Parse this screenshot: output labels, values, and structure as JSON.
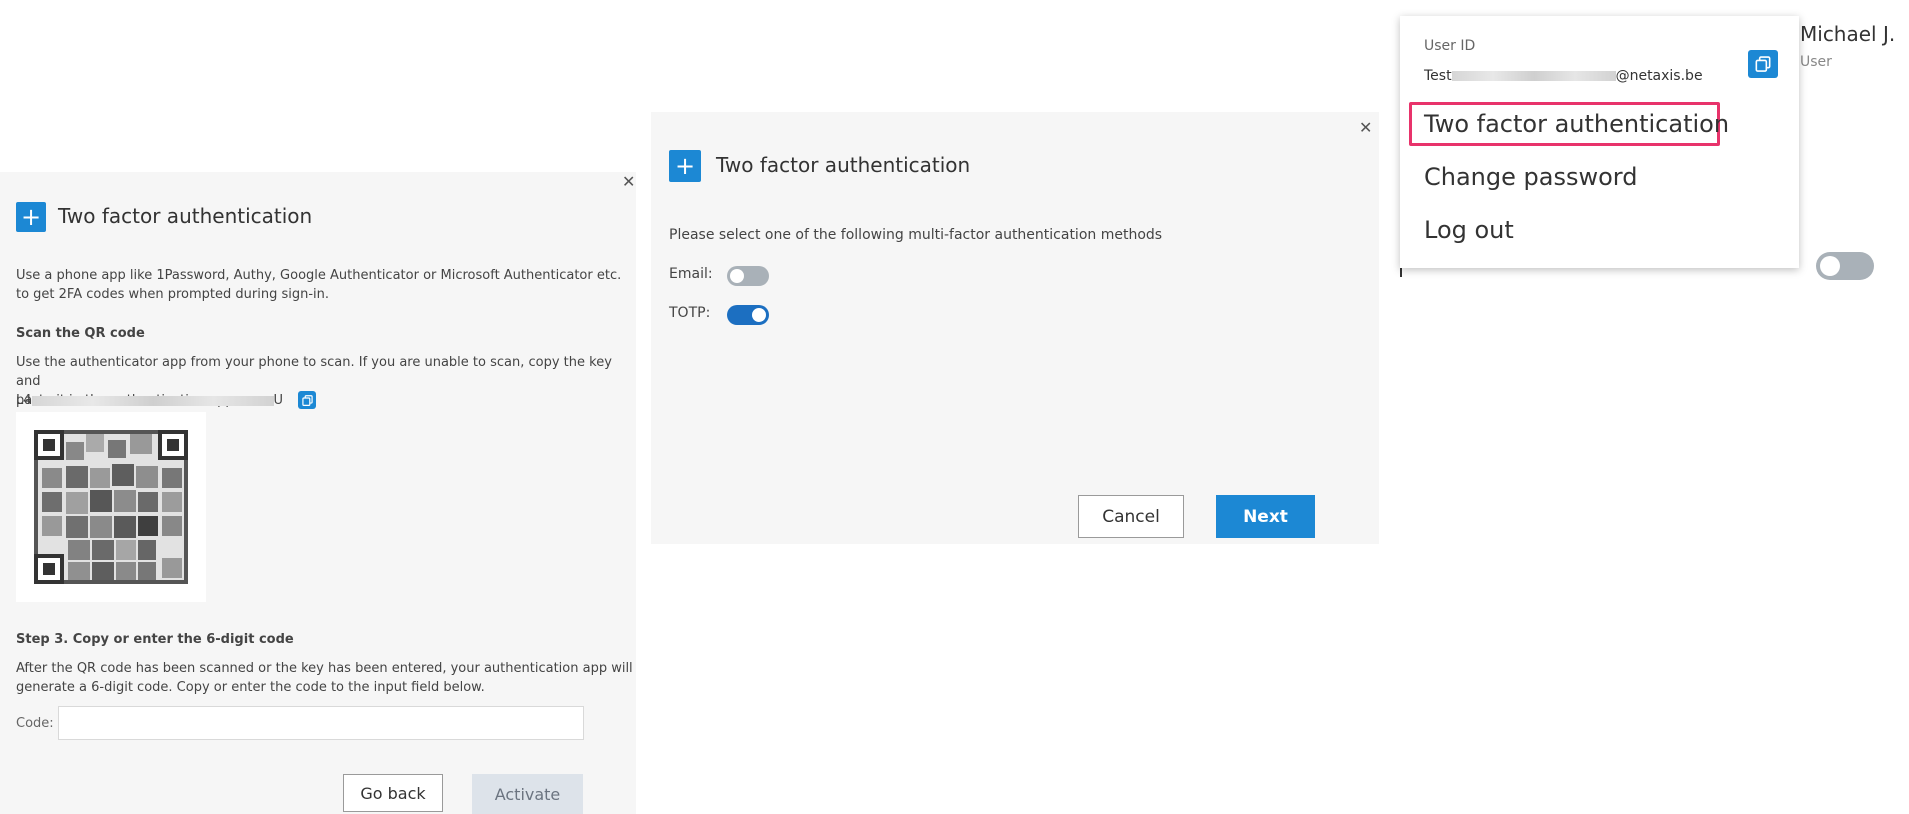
{
  "left_dialog": {
    "title": "Two factor authentication",
    "intro_line1": "Use a phone app like 1Password, Authy, Google Authenticator or Microsoft Authenticator etc.",
    "intro_line2": "to get 2FA codes when prompted during sign-in.",
    "scan_heading": "Scan the QR code",
    "scan_line1": "Use the authenticator app from your phone to scan. If you are unable to scan, copy the key and",
    "scan_line2": "paste it in the authentication app.",
    "key_start": "L4",
    "key_end": "U",
    "step3_heading": "Step 3. Copy or enter the 6-digit code",
    "step3_line1": "After the QR code has been scanned or the key has been entered, your authentication app will",
    "step3_line2": "generate a 6-digit code. Copy or enter the code to the input field below.",
    "code_label": "Code:",
    "code_value": "",
    "go_back_label": "Go back",
    "activate_label": "Activate"
  },
  "middle_dialog": {
    "title": "Two factor authentication",
    "instruction": "Please select one of the following multi-factor authentication methods",
    "methods": [
      {
        "label": "Email:",
        "enabled": false
      },
      {
        "label": "TOTP:",
        "enabled": true
      }
    ],
    "cancel_label": "Cancel",
    "next_label": "Next"
  },
  "user_menu": {
    "user_id_label": "User ID",
    "user_id_start": "Test",
    "user_id_end": "@netaxis.be",
    "items": [
      {
        "label": "Two factor authentication",
        "highlighted": true
      },
      {
        "label": "Change password",
        "highlighted": false
      },
      {
        "label": "Log out",
        "highlighted": false
      }
    ]
  },
  "profile": {
    "name": "Michael J.",
    "role": "User",
    "toggle_enabled": false
  },
  "colors": {
    "accent": "#1c88d4",
    "highlight": "#e8336b",
    "toggle_on": "#1c6fc1",
    "toggle_off": "#a9b1b8"
  }
}
